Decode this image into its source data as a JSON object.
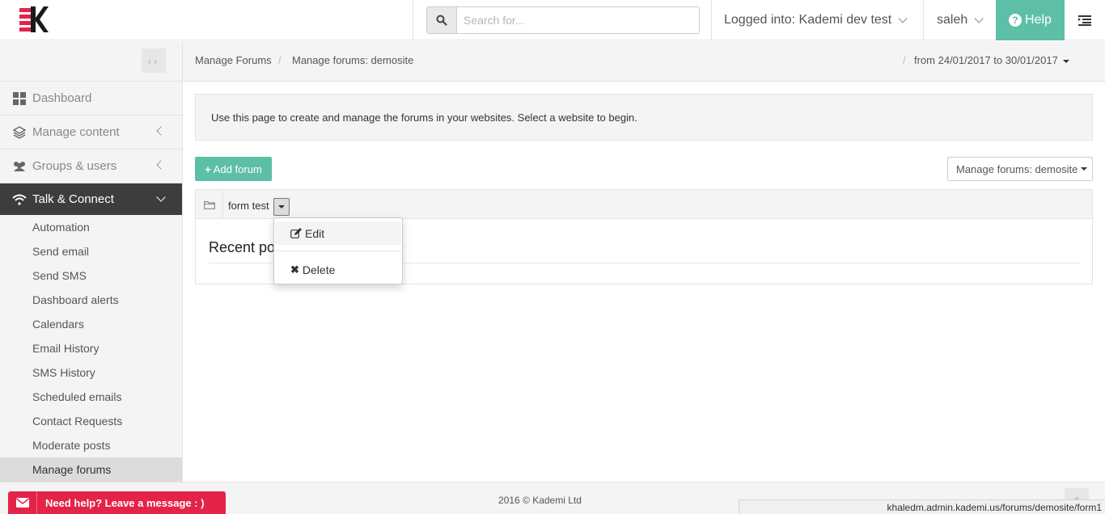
{
  "header": {
    "search_placeholder": "Search for...",
    "logged_into": "Logged into: Kademi dev test",
    "user": "saleh",
    "help_label": "Help"
  },
  "sidebar": {
    "items": [
      {
        "label": "Dashboard",
        "icon": "dashboard-grid-icon"
      },
      {
        "label": "Manage content",
        "icon": "layers-icon"
      },
      {
        "label": "Groups & users",
        "icon": "users-icon"
      },
      {
        "label": "Talk & Connect",
        "icon": "wifi-icon"
      }
    ],
    "sub_items": [
      "Automation",
      "Send email",
      "Send SMS",
      "Dashboard alerts",
      "Calendars",
      "Email History",
      "SMS History",
      "Scheduled emails",
      "Contact Requests",
      "Moderate posts",
      "Manage forums"
    ]
  },
  "breadcrumb": {
    "item1": "Manage Forums",
    "item2": "Manage forums: demosite",
    "separator": "/",
    "date_range": "from 24/01/2017 to 30/01/2017"
  },
  "main": {
    "info_text": "Use this page to create and manage the forums in your websites. Select a website to begin.",
    "add_forum_label": "Add forum",
    "site_select_label": "Manage forums: demosite",
    "forum": {
      "name": "form test",
      "recent_posts": "Recent posts"
    },
    "dropdown": {
      "edit_label": "Edit",
      "delete_label": "Delete"
    }
  },
  "footer": {
    "copyright": "2016 © Kademi Ltd",
    "help_widget": "Need help? Leave a message : )",
    "status_url": "khaledm.admin.kademi.us/forums/demosite/form1"
  },
  "colors": {
    "accent": "#5dbfa6",
    "active_nav": "#3d3d3d",
    "help_widget": "#e42348",
    "logo_dark": "#1a1a1a",
    "logo_red": "#e42348"
  }
}
